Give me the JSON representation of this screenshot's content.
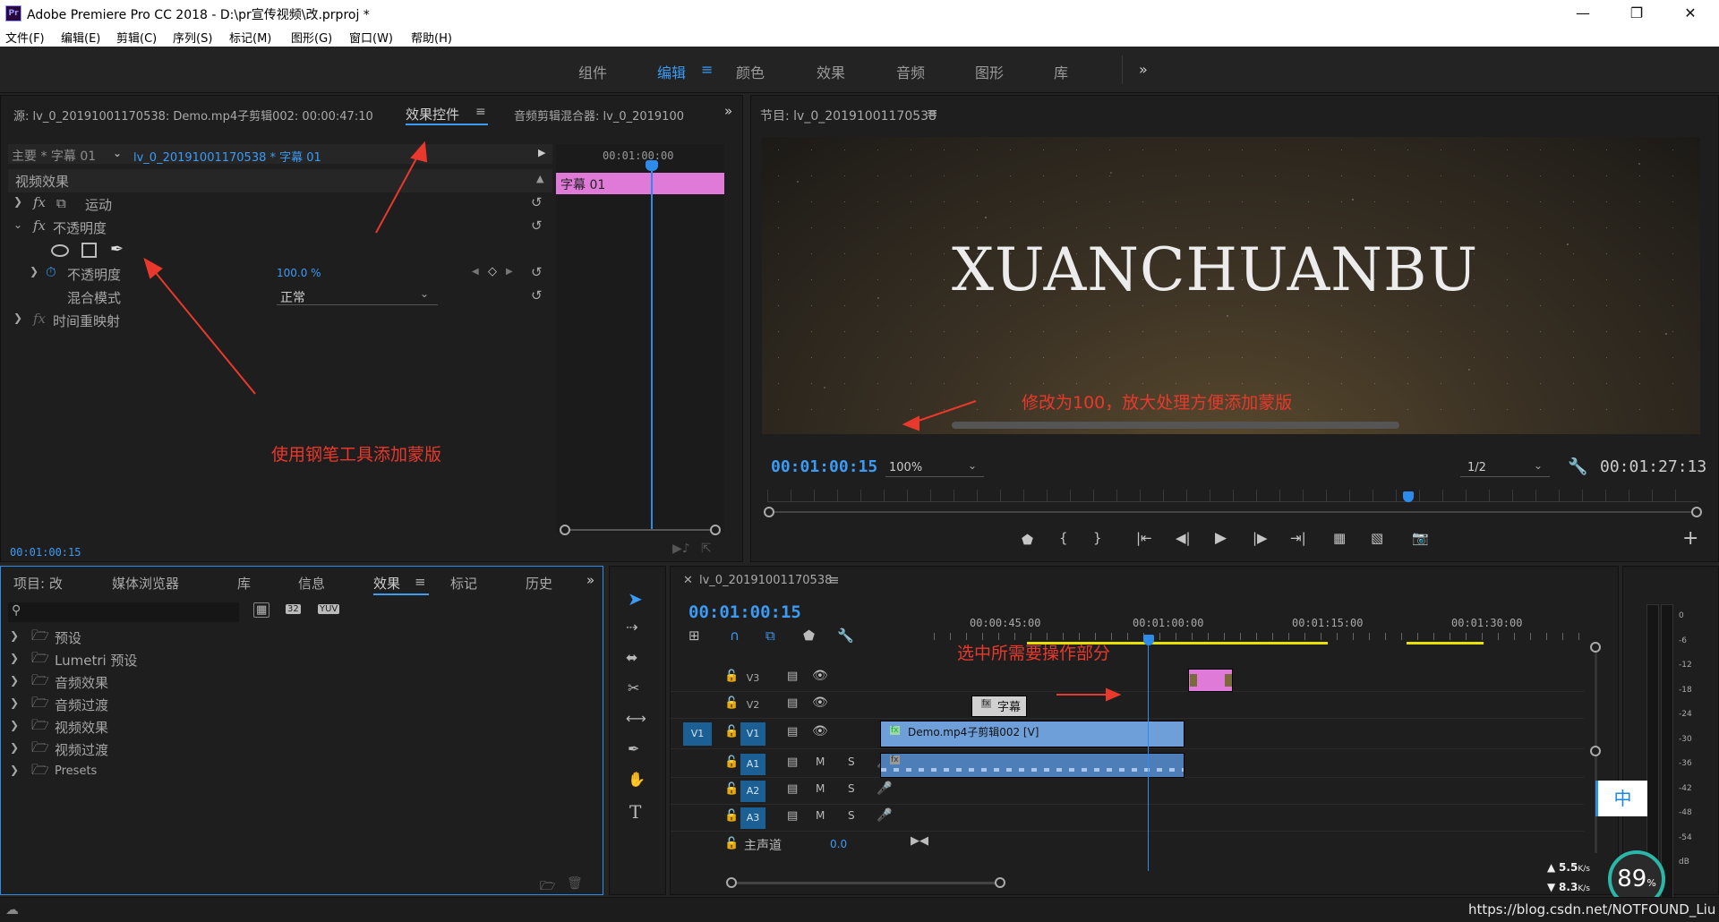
{
  "window": {
    "title": "Adobe Premiere Pro CC 2018 - D:\\pr宣传视频\\改.prproj *",
    "logo": "Pr",
    "min_icon": "minimize-icon",
    "max_icon": "maximize-icon",
    "close_icon": "close-icon"
  },
  "menu": [
    "文件(F)",
    "编辑(E)",
    "剪辑(C)",
    "序列(S)",
    "标记(M)",
    "图形(G)",
    "窗口(W)",
    "帮助(H)"
  ],
  "workspaces": {
    "items": [
      "组件",
      "编辑",
      "颜色",
      "效果",
      "音频",
      "图形",
      "库"
    ],
    "active": "编辑",
    "more": "»"
  },
  "source_panel": {
    "tab_source": "源: lv_0_20191001170538: Demo.mp4子剪辑002: 00:00:47:10",
    "tab_effects": "效果控件",
    "tab_mixer": "音频剪辑混合器: lv_0_2019100",
    "more": "»",
    "master": "主要 * 字幕 01",
    "clip": "lv_0_20191001170538 * 字幕 01",
    "timeline_tc": "00:01:00:00",
    "clip_label": "字幕 01",
    "section": "视频效果",
    "fx_motion": "运动",
    "fx_opacity": "不透明度",
    "prop_opacity": "不透明度",
    "prop_opacity_value": "100.0 %",
    "prop_blend": "混合模式",
    "prop_blend_value": "正常",
    "fx_time": "时间重映射",
    "fx": "fx",
    "timecode": "00:01:00:15"
  },
  "program": {
    "title": "节目: lv_0_20191001170538",
    "video_text": "XUANCHUANBU",
    "timecode": "00:01:00:15",
    "zoom": "100%",
    "resolution": "1/2",
    "duration": "00:01:27:13"
  },
  "project_panel": {
    "tabs": [
      "项目: 改",
      "媒体浏览器",
      "库",
      "信息",
      "效果",
      "标记",
      "历史"
    ],
    "active_tab": "效果",
    "more": "»",
    "icon_labels": [
      "32",
      "YUV"
    ],
    "folders": [
      "预设",
      "Lumetri 预设",
      "音频效果",
      "音频过渡",
      "视频效果",
      "视频过渡",
      "Presets"
    ]
  },
  "tools": [
    "selection-tool",
    "track-select-tool",
    "ripple-edit-tool",
    "razor-tool",
    "slip-tool",
    "pen-tool",
    "hand-tool",
    "type-tool"
  ],
  "timeline": {
    "title": "lv_0_20191001170538",
    "timecode": "00:01:00:15",
    "ruler": [
      "00:00:45:00",
      "00:01:00:00",
      "00:01:15:00",
      "00:01:30:00"
    ],
    "tracks": [
      {
        "id": "V3",
        "src": ""
      },
      {
        "id": "V2",
        "src": ""
      },
      {
        "id": "V1",
        "src": "V1"
      },
      {
        "id": "A1",
        "src": ""
      },
      {
        "id": "A2",
        "src": ""
      },
      {
        "id": "A3",
        "src": ""
      }
    ],
    "mute": "M",
    "solo": "S",
    "master": "主声道",
    "master_value": "0.0",
    "clip_title": "字幕",
    "clip_video": "Demo.mp4子剪辑002 [V]",
    "fx_badge": "fx"
  },
  "meters": {
    "scale": [
      "0",
      "-6",
      "-12",
      "-18",
      "-24",
      "-30",
      "-36",
      "-42",
      "-48",
      "-54",
      "dB"
    ]
  },
  "annotations": {
    "pen": "使用钢笔工具添加蒙版",
    "modify": "修改为100，放大处理方便添加蒙版",
    "select": "选中所需要操作部分"
  },
  "overlay": {
    "ime": "中",
    "up": "5.5",
    "down": "8.3",
    "unit": "K/s",
    "percent": "89",
    "percent_sign": "%",
    "watermark": "https://blog.csdn.net/NOTFOUND_Liu"
  },
  "colors": {
    "accent": "#3b9bf5",
    "pink": "#e07ad8",
    "clip_blue": "#6f9fd8",
    "annotation": "#e8392c",
    "yellow": "#e5e000"
  }
}
